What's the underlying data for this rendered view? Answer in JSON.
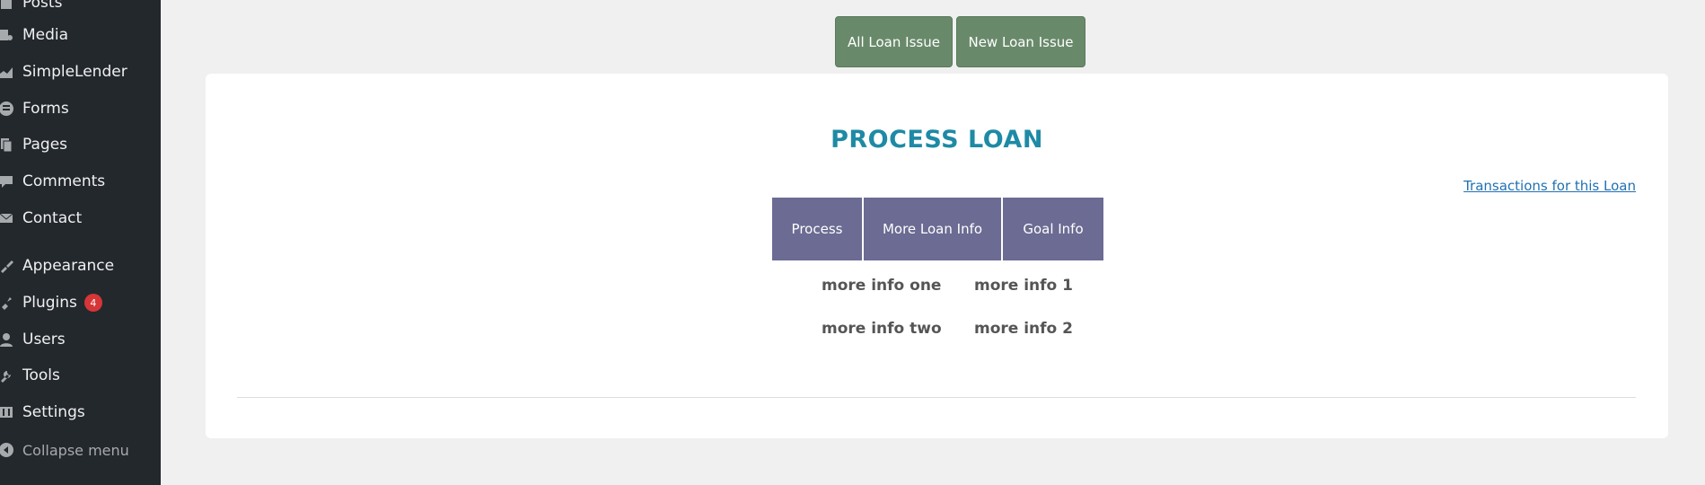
{
  "sidebar": {
    "items": [
      {
        "label": "Posts",
        "icon": "posts-icon"
      },
      {
        "label": "Media",
        "icon": "media-icon"
      },
      {
        "label": "SimpleLender",
        "icon": "chart-icon"
      },
      {
        "label": "Forms",
        "icon": "forms-icon"
      },
      {
        "label": "Pages",
        "icon": "pages-icon"
      },
      {
        "label": "Comments",
        "icon": "comments-icon"
      },
      {
        "label": "Contact",
        "icon": "mail-icon"
      },
      {
        "label": "Appearance",
        "icon": "brush-icon"
      },
      {
        "label": "Plugins",
        "icon": "plugin-icon",
        "badge": "4"
      },
      {
        "label": "Users",
        "icon": "user-icon"
      },
      {
        "label": "Tools",
        "icon": "wrench-icon"
      },
      {
        "label": "Settings",
        "icon": "settings-icon"
      }
    ],
    "collapse_label": "Collapse menu"
  },
  "toolbar": {
    "all_loan_label": "All Loan Issue",
    "new_loan_label": "New Loan Issue"
  },
  "main": {
    "title": "PROCESS LOAN",
    "transactions_link": "Transactions for this Loan",
    "tabs": [
      {
        "label": "Process"
      },
      {
        "label": "More Loan Info"
      },
      {
        "label": "Goal Info"
      }
    ],
    "info": {
      "row1_left": "more info one",
      "row1_right": "more info 1",
      "row2_left": "more info two",
      "row2_right": "more info 2"
    }
  },
  "colors": {
    "sidebar_bg": "#23282d",
    "button_green": "#698a6a",
    "tab_purple": "#6b6b93",
    "title_teal": "#1e8aa5",
    "badge_red": "#d63638"
  }
}
